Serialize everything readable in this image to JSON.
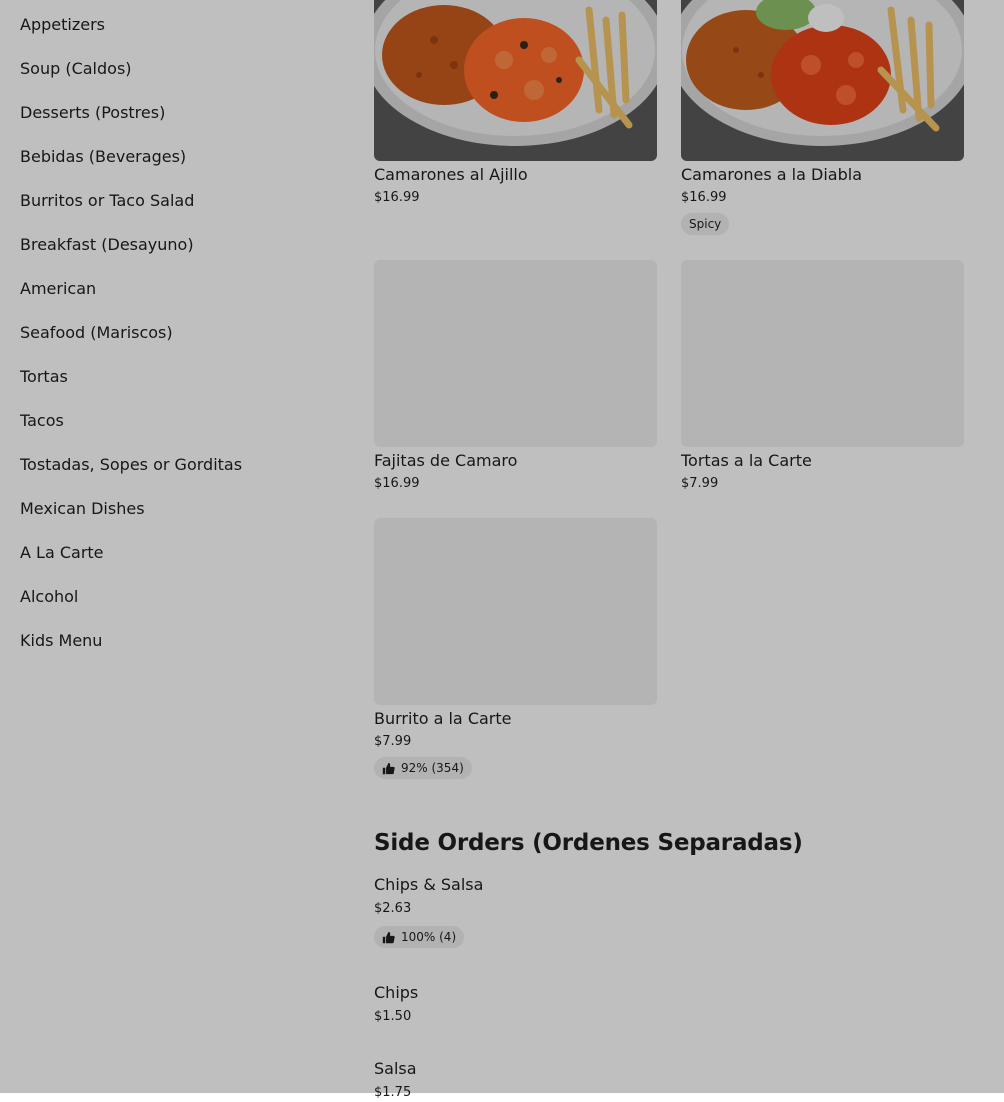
{
  "sidebar": {
    "categories": [
      "Appetizers",
      "Soup (Caldos)",
      "Desserts (Postres)",
      "Bebidas (Beverages)",
      "Burritos or Taco Salad",
      "Breakfast (Desayuno)",
      "American",
      "Seafood (Mariscos)",
      "Tortas",
      "Tacos",
      "Tostadas, Sopes or Gorditas",
      "Mexican Dishes",
      "A La Carte",
      "Alcohol",
      "Kids Menu"
    ]
  },
  "items": [
    {
      "name": "Camarones al Ajillo",
      "price": "$16.99"
    },
    {
      "name": "Camarones a la Diabla",
      "price": "$16.99",
      "tag": "Spicy"
    },
    {
      "name": "Fajitas de Camaro",
      "price": "$16.99"
    },
    {
      "name": "Tortas a la Carte",
      "price": "$7.99"
    },
    {
      "name": "Burrito a la Carte",
      "price": "$7.99",
      "rating": "92% (354)"
    }
  ],
  "side_orders": {
    "title": "Side Orders (Ordenes Separadas)",
    "items": [
      {
        "name": "Chips & Salsa",
        "price": "$2.63",
        "rating": "100% (4)"
      },
      {
        "name": "Chips",
        "price": "$1.50"
      },
      {
        "name": "Salsa",
        "price": "$1.75"
      }
    ]
  },
  "colors": {
    "backdrop": "#000000",
    "placeholder": "#f1f1f1",
    "pill": "#eeeeee",
    "text": "#1f1f1f"
  }
}
